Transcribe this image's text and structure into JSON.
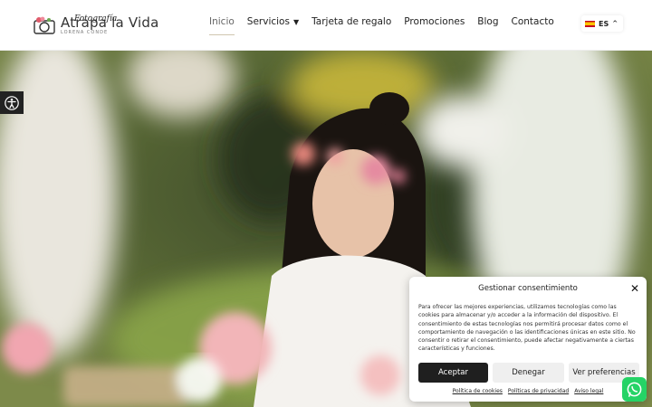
{
  "brand": {
    "title": "Atrapa la Vida",
    "subtitle": "LORENA CONDE",
    "script": "Fotografía"
  },
  "nav": {
    "items": [
      {
        "label": "Inicio",
        "active": true
      },
      {
        "label": "Servicios",
        "has_dropdown": true
      },
      {
        "label": "Tarjeta de regalo"
      },
      {
        "label": "Promociones"
      },
      {
        "label": "Blog"
      },
      {
        "label": "Contacto"
      }
    ]
  },
  "language": {
    "code": "ES",
    "icon": "spain-flag-icon"
  },
  "accessibility": {
    "icon": "accessibility-icon"
  },
  "consent": {
    "title": "Gestionar consentimiento",
    "text": "Para ofrecer las mejores experiencias, utilizamos tecnologías como las cookies para almacenar y/o acceder a la información del dispositivo. El consentimiento de estas tecnologías nos permitirá procesar datos como el comportamiento de navegación o las identificaciones únicas en este sitio. No consentir o retirar el consentimiento, puede afectar negativamente a ciertas características y funciones.",
    "accept_label": "Aceptar",
    "deny_label": "Denegar",
    "prefs_label": "Ver preferencias",
    "links": [
      "Política de cookies",
      "Políticas de privacidad",
      "Aviso legal"
    ]
  },
  "whatsapp": {
    "icon": "whatsapp-icon"
  },
  "colors": {
    "accept_bg": "#1f1f1f",
    "whatsapp": "#25d366",
    "active_underline": "#d0c6b0"
  }
}
